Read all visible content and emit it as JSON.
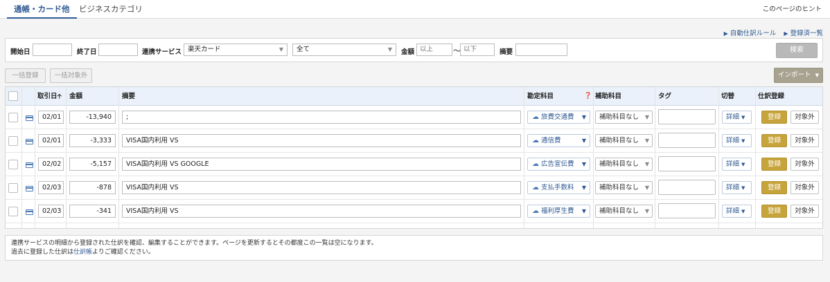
{
  "tabs": {
    "active": "通帳・カード他",
    "inactive": "ビジネスカテゴリ"
  },
  "hint_link": "このページのヒント",
  "links": {
    "auto_rules": "自動仕訳ルール",
    "registered_list": "登録済一覧"
  },
  "filter": {
    "start_label": "開始日",
    "end_label": "終了日",
    "service_label": "連携サービス",
    "service_value": "楽天カード",
    "status_value": "全て",
    "amount_label": "金額",
    "amount_min_placeholder": "以上",
    "amount_tilde": "〜",
    "amount_max_placeholder": "以下",
    "memo_label": "摘要",
    "search_button": "検索"
  },
  "actions": {
    "bulk_register": "一括登録",
    "bulk_exclude": "一括対象外",
    "import": "インポート"
  },
  "table": {
    "headers": {
      "date": "取引日",
      "date_sort_icon": "sort-up-arrow",
      "amount": "金額",
      "memo": "摘要",
      "account": "勘定科目",
      "account_help_icon": "question-circle",
      "sub_account": "補助科目",
      "tag": "タグ",
      "toggle": "切替",
      "register": "仕訳登録"
    },
    "rows": [
      {
        "date": "02/01",
        "amount": "-13,940",
        "memo": ";",
        "account": "旅費交通費",
        "sub": "補助科目なし",
        "detail": "詳細",
        "reg": "登録",
        "excl": "対象外"
      },
      {
        "date": "02/01",
        "amount": "-3,333",
        "memo": "VISA国内利用 VS",
        "account": "通信費",
        "sub": "補助科目なし",
        "detail": "詳細",
        "reg": "登録",
        "excl": "対象外"
      },
      {
        "date": "02/02",
        "amount": "-5,157",
        "memo": "VISA国内利用 VS GOOGLE",
        "account": "広告宣伝費",
        "sub": "補助科目なし",
        "detail": "詳細",
        "reg": "登録",
        "excl": "対象外"
      },
      {
        "date": "02/03",
        "amount": "-878",
        "memo": "VISA国内利用 VS",
        "account": "支払手数料",
        "sub": "補助科目なし",
        "detail": "詳細",
        "reg": "登録",
        "excl": "対象外"
      },
      {
        "date": "02/03",
        "amount": "-341",
        "memo": "VISA国内利用 VS",
        "account": "福利厚生費",
        "sub": "補助科目なし",
        "detail": "詳細",
        "reg": "登録",
        "excl": "対象外"
      }
    ]
  },
  "note": {
    "line1": "連携サービスの明細から登録された仕訳を確認、編集することができます。ページを更新するとその都度この一覧は空になります。",
    "line2_prefix": "過去に登録した仕訳は",
    "line2_link": "仕訳帳",
    "line2_suffix": "よりご確認ください。"
  }
}
